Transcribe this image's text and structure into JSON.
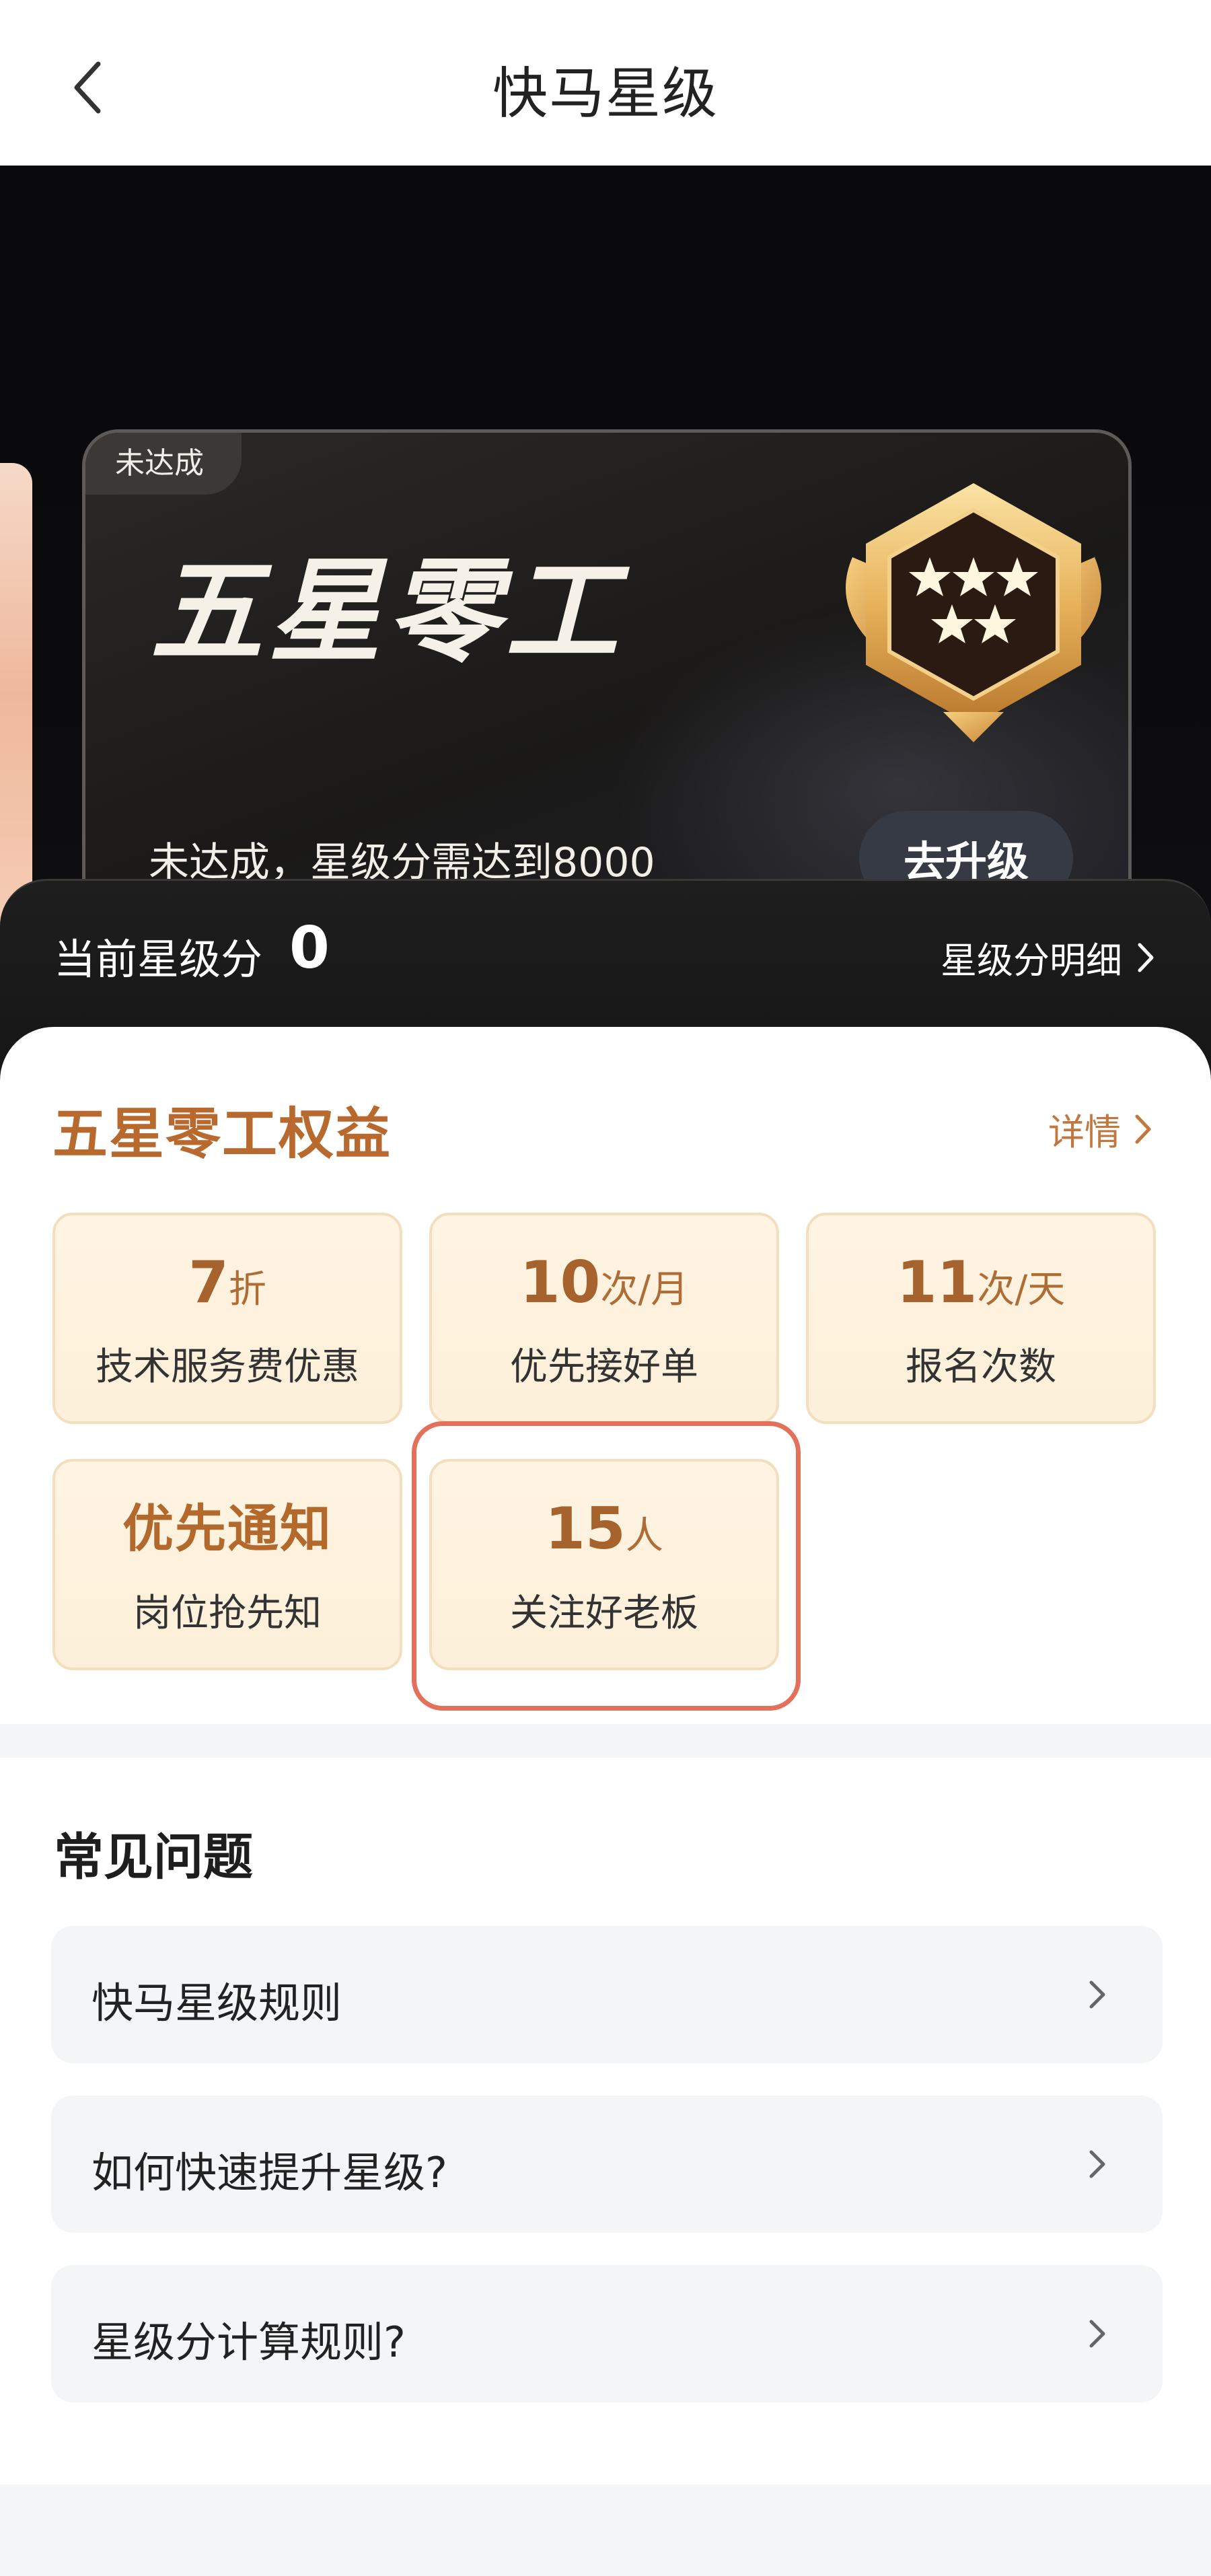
{
  "header": {
    "title": "快马星级",
    "back_icon": "chevron-left-icon"
  },
  "level_card": {
    "status_tag": "未达成",
    "level_name": "五星零工",
    "description": "未达成，星级分需达到8000",
    "upgrade_button": "去升级",
    "badge_icon": "five-star-medal-icon",
    "badge_stars": 5
  },
  "score": {
    "label": "当前星级分",
    "value": "0",
    "detail_link": "星级分明细"
  },
  "benefits": {
    "title": "五星零工权益",
    "detail_link": "详情",
    "items": [
      {
        "value": "7",
        "unit": "折",
        "label": "技术服务费优惠"
      },
      {
        "value": "10",
        "unit": "次/月",
        "label": "优先接好单"
      },
      {
        "value": "11",
        "unit": "次/天",
        "label": "报名次数"
      },
      {
        "value": "优先通知",
        "unit": "",
        "label": "岗位抢先知"
      },
      {
        "value": "15",
        "unit": "人",
        "label": "关注好老板"
      }
    ],
    "highlighted_index": 4
  },
  "faq": {
    "title": "常见问题",
    "items": [
      {
        "label": "快马星级规则"
      },
      {
        "label": "如何快速提升星级?"
      },
      {
        "label": "星级分计算规则?"
      }
    ]
  },
  "colors": {
    "accent_brown": "#b8692e",
    "card_bg": "#fff4e2",
    "highlight": "#e2705a",
    "dark_bg": "#0b0b0d"
  }
}
